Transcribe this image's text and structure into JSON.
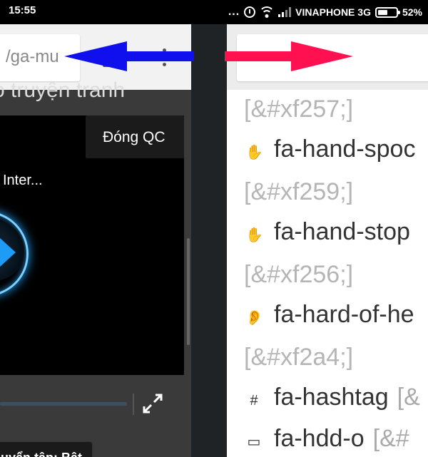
{
  "status_bar": {
    "time": "15:55",
    "dots": "...",
    "carrier": "VINAPHONE 3G",
    "battery": "52%"
  },
  "left_browser": {
    "url_text": "/ga-mu",
    "page_title": "o truyện tranh",
    "ad_close_label": "Đóng QC",
    "video_title": "Inter...",
    "playlist_toggle": "uyển tập: Bật"
  },
  "right_browser": {
    "url_text": "",
    "items": [
      {
        "kind": "code",
        "text": "[&#xf257;]"
      },
      {
        "kind": "icon",
        "icon": "hand-spock-icon",
        "glyph": "✋",
        "name": "fa-hand-spoc",
        "code": ""
      },
      {
        "kind": "code",
        "text": "[&#xf259;]"
      },
      {
        "kind": "icon",
        "icon": "hand-stop-icon",
        "glyph": "✋",
        "name": "fa-hand-stop",
        "code": ""
      },
      {
        "kind": "code",
        "text": "[&#xf256;]"
      },
      {
        "kind": "icon",
        "icon": "hard-of-hearing-icon",
        "glyph": "👂",
        "name": "fa-hard-of-he",
        "code": ""
      },
      {
        "kind": "code",
        "text": "[&#xf2a4;]"
      },
      {
        "kind": "icon",
        "icon": "hashtag-icon",
        "glyph": "#",
        "name": "fa-hashtag",
        "code": "[&"
      },
      {
        "kind": "icon",
        "icon": "hdd-icon",
        "glyph": "▭",
        "name": "fa-hdd-o",
        "code": "[&#"
      }
    ]
  },
  "annotations": {
    "blue_arrow_color": "#1010ee",
    "red_arrow_color": "#ff1050"
  }
}
